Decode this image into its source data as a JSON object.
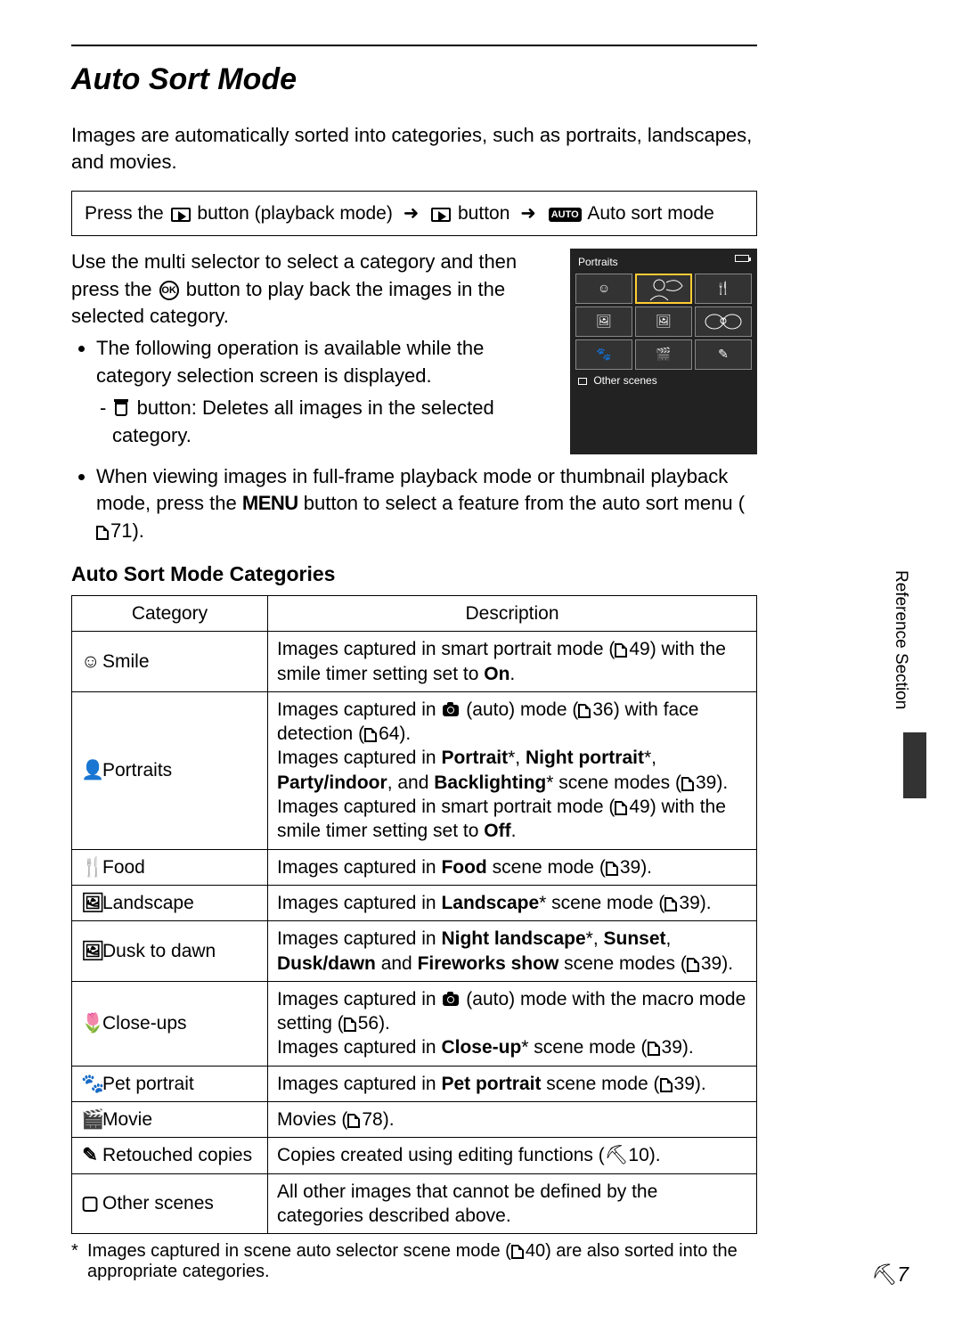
{
  "title": "Auto Sort Mode",
  "intro": "Images are automatically sorted into categories, such as portraits, landscapes, and movies.",
  "nav": {
    "prefix": "Press the ",
    "step1": " button (playback mode)",
    "step2": " button",
    "auto_badge": "AUTO",
    "mode_label": " Auto sort mode"
  },
  "body": {
    "line1a": "Use the multi selector to select a category and then press the ",
    "ok_label": "OK",
    "line1b": " button to play back the images in the selected category.",
    "b1": "The following operation is available while the category selection screen is displayed.",
    "b1sub": " button: Deletes all images in the selected category.",
    "b2a": "When viewing images in full-frame playback mode or thumbnail playback mode, press the ",
    "menu_label": "MENU",
    "b2b": " button to select a feature from the auto sort menu (",
    "b2ref": "71).",
    "lcd_header": "Portraits",
    "lcd_footer": "Other scenes"
  },
  "subheading": "Auto Sort Mode Categories",
  "table": {
    "h1": "Category",
    "h2": "Description"
  },
  "rows": [
    {
      "icon": "☺",
      "name": "Smile",
      "desc_parts": [
        {
          "t": "Images captured in smart portrait mode ("
        },
        {
          "p": "49"
        },
        {
          "t": ") with the smile timer setting set to "
        },
        {
          "b": "On"
        },
        {
          "t": "."
        }
      ]
    },
    {
      "icon": "👤",
      "name": "Portraits",
      "desc_parts": [
        {
          "t": "Images captured in "
        },
        {
          "cam": true
        },
        {
          "t": " (auto) mode ("
        },
        {
          "p": "36"
        },
        {
          "t": ") with face detection ("
        },
        {
          "p": "64"
        },
        {
          "t": ")."
        },
        {
          "br": true
        },
        {
          "t": "Images captured in "
        },
        {
          "b": "Portrait"
        },
        {
          "t": "*, "
        },
        {
          "b": "Night portrait"
        },
        {
          "t": "*, "
        },
        {
          "b": "Party/indoor"
        },
        {
          "t": ", and "
        },
        {
          "b": "Backlighting"
        },
        {
          "t": "* scene modes ("
        },
        {
          "p": "39"
        },
        {
          "t": ")."
        },
        {
          "br": true
        },
        {
          "t": "Images captured in smart portrait mode ("
        },
        {
          "p": "49"
        },
        {
          "t": ") with the smile timer setting set to "
        },
        {
          "b": "Off"
        },
        {
          "t": "."
        }
      ]
    },
    {
      "icon": "🍴",
      "name": "Food",
      "desc_parts": [
        {
          "t": "Images captured in "
        },
        {
          "b": "Food"
        },
        {
          "t": " scene mode ("
        },
        {
          "p": "39"
        },
        {
          "t": ")."
        }
      ]
    },
    {
      "icon": "🖼",
      "name": "Landscape",
      "desc_parts": [
        {
          "t": "Images captured in "
        },
        {
          "b": "Landscape"
        },
        {
          "t": "* scene mode ("
        },
        {
          "p": "39"
        },
        {
          "t": ")."
        }
      ]
    },
    {
      "icon": "🖼",
      "name": "Dusk to dawn",
      "desc_parts": [
        {
          "t": "Images captured in "
        },
        {
          "b": "Night landscape"
        },
        {
          "t": "*, "
        },
        {
          "b": "Sunset"
        },
        {
          "t": ", "
        },
        {
          "b": "Dusk/dawn"
        },
        {
          "t": " and "
        },
        {
          "b": "Fireworks show"
        },
        {
          "t": " scene modes ("
        },
        {
          "p": "39"
        },
        {
          "t": ")."
        }
      ]
    },
    {
      "icon": "🌷",
      "name": "Close-ups",
      "desc_parts": [
        {
          "t": "Images captured in "
        },
        {
          "cam": true
        },
        {
          "t": " (auto) mode with the macro mode setting ("
        },
        {
          "p": "56"
        },
        {
          "t": ")."
        },
        {
          "br": true
        },
        {
          "t": "Images captured in "
        },
        {
          "b": "Close-up"
        },
        {
          "t": "* scene mode ("
        },
        {
          "p": "39"
        },
        {
          "t": ")."
        }
      ]
    },
    {
      "icon": "🐾",
      "name": "Pet portrait",
      "desc_parts": [
        {
          "t": "Images captured in "
        },
        {
          "b": "Pet portrait"
        },
        {
          "t": " scene mode ("
        },
        {
          "p": "39"
        },
        {
          "t": ")."
        }
      ]
    },
    {
      "icon": "🎬",
      "name": "Movie",
      "desc_parts": [
        {
          "t": "Movies ("
        },
        {
          "p": "78"
        },
        {
          "t": ")."
        }
      ]
    },
    {
      "icon": "✎",
      "name": "Retouched copies",
      "desc_parts": [
        {
          "t": "Copies created using editing functions ("
        },
        {
          "k": "10"
        },
        {
          "t": ")."
        }
      ]
    },
    {
      "icon": "▢",
      "name": "Other scenes",
      "desc_parts": [
        {
          "t": "All other images that cannot be defined by the categories described above."
        }
      ]
    }
  ],
  "footnote": {
    "star": "*",
    "text_a": "Images captured in scene auto selector scene mode (",
    "ref": "40",
    "text_b": ") are also sorted into the appropriate categories."
  },
  "side_label": "Reference Section",
  "page_num": "7"
}
